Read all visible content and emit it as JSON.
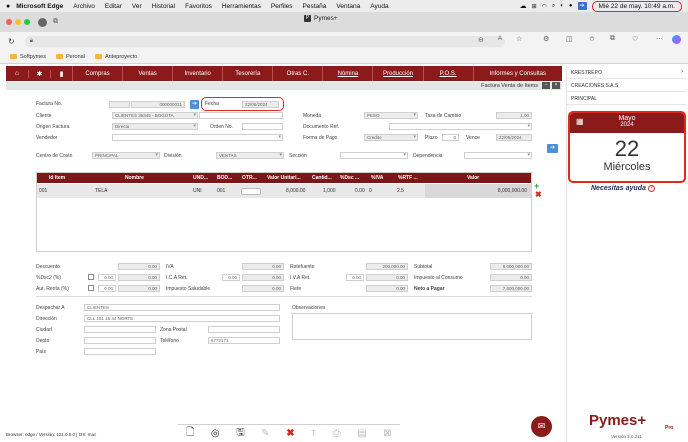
{
  "os_menu": {
    "app": "Microsoft Edge",
    "items": [
      "Archivo",
      "Editar",
      "Ver",
      "Historial",
      "Favoritos",
      "Herramientas",
      "Perfiles",
      "Pestaña",
      "Ventana",
      "Ayuda"
    ],
    "datetime": "Mié 22 de may.  10:49 a.m."
  },
  "browser": {
    "tab_title": "Pymes+",
    "bookmarks": [
      "Softpymes",
      "Peronal",
      "Anteproyecto"
    ]
  },
  "nav": {
    "items": [
      "Compras",
      "Ventas",
      "Inventario",
      "Tesorería",
      "Otras C.",
      "Nómina",
      "Producción",
      "P.O.S.",
      "Informes y Consultas"
    ]
  },
  "document": {
    "title": "Factura Venta de Items"
  },
  "form": {
    "factura_label": "Factura No.",
    "factura_value": "000000031",
    "fecha_label": "Fecha",
    "fecha_value": "22/05/2024",
    "moneda_label": "Moneda",
    "moneda_value": "PESO",
    "tasa_label": "Tasa de Cambio",
    "tasa_value": "1.00",
    "cliente_label": "Cliente",
    "cliente_value": "CLIENTES 35345 - BOGOTA",
    "origen_label": "Origen Factura",
    "origen_value": "Directa",
    "orden_label": "Orden No.",
    "docref_label": "Documento Ref.",
    "vendedor_label": "Vendedor",
    "formapago_label": "Forma de Pago",
    "formapago_value": "Credito",
    "plazo_label": "Plazo",
    "plazo_value": "0",
    "vence_label": "Vence",
    "vence_value": "22/05/2024",
    "centro_label": "Centro de Costo",
    "centro_value": "PRINCIPAL",
    "division_label": "División",
    "division_value": "VENTAS",
    "seccion_label": "Sección",
    "dependencia_label": "Dependencia"
  },
  "table": {
    "headers": [
      "Id Item",
      "Nombre",
      "UND...",
      "BOD...",
      "OTR...",
      "Valor Unitari...",
      "Cantid...",
      "%Dsc ...",
      "%IVA",
      "%RTF ...",
      "Valor"
    ],
    "row": [
      "001",
      "TELA",
      "UNI",
      "001",
      "",
      "8,000.00",
      "1,000",
      "0.00",
      "0",
      "2.5",
      "8,000,000.00"
    ]
  },
  "totals": {
    "descuento_label": "Descuento",
    "descuento_value": "0.00",
    "iva_label": "IVA",
    "iva_value": "0.00",
    "retefuente_label": "Retefuente",
    "retefuente_value": "200,000.00",
    "subtotal_label": "Subtotal",
    "subtotal_value": "8,000,000.00",
    "dsc2_label": "%Dsc2 (%)",
    "dsc2_pct": "0.00",
    "dsc2_value": "0.00",
    "icaret_label": "I.C.A Ret.",
    "icaret_pct": "0.00",
    "icaret_value": "0.00",
    "ivaret_label": "I.V.A Ret.",
    "ivaret_pct": "0.00",
    "ivaret_value": "0.00",
    "consumo_label": "Impuesto al Consumo",
    "consumo_value": "0.00",
    "autrenta_label": "Aut. Renta (%)",
    "autrenta_pct": "0.00",
    "autrenta_value": "0.00",
    "saludable_label": "Impuesto Saludable",
    "saludable_value": "0.00",
    "flete_label": "Flete",
    "flete_value": "0.00",
    "neto_label": "Neto a Pagar",
    "neto_value": "7,800,000.00"
  },
  "shipping": {
    "despachar_label": "Despachar A",
    "despachar_value": "CLIENTES",
    "direccion_label": "Dirección",
    "direccion_value": "CLL 161 15 44 NORTE",
    "ciudad_label": "Ciudad",
    "zona_label": "Zona Postal",
    "depto_label": "Depto",
    "telefono_label": "Teléfono",
    "telefono_value": "6772171",
    "pais_label": "País",
    "observaciones_label": "Observaciones"
  },
  "sidebar": {
    "items": [
      "KRESTREPO",
      "CREACIONES S.A.S",
      "PRINCIPAL"
    ],
    "month": "Mayo",
    "year": "2024",
    "day": "22",
    "weekday": "Miércoles",
    "help": "Necesitas ayuda"
  },
  "footer": {
    "browser_info": "Browser:  edge / Versión: 121.0.0.0 | OS: mac",
    "brand": "Pymes+",
    "brand_sub": "Pro",
    "version": "Versión 2.0.211"
  },
  "colors": {
    "brand": "#8b1a1a",
    "highlight": "#e02a1e",
    "nav_text": "#ffffff"
  }
}
